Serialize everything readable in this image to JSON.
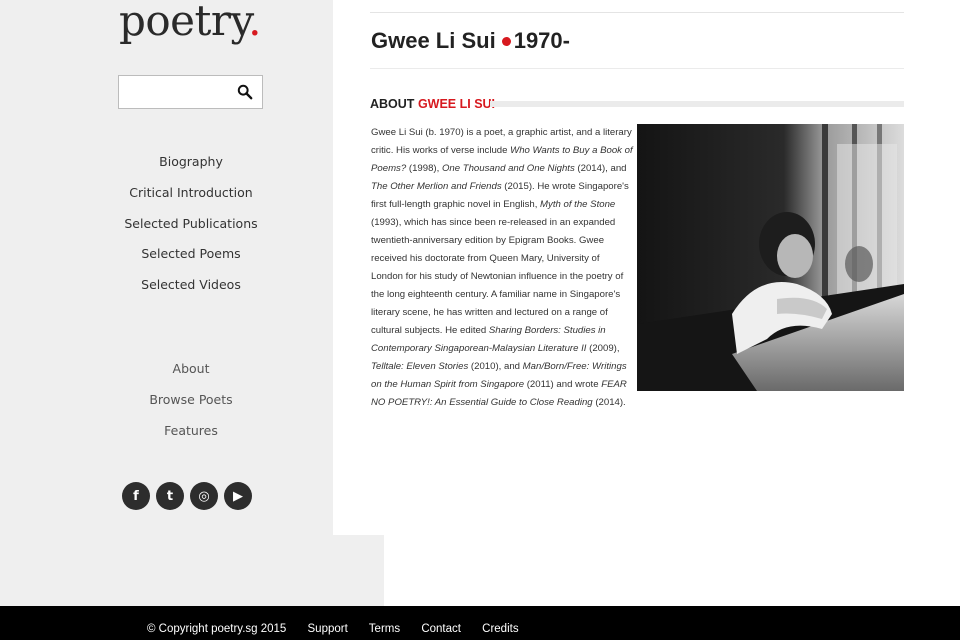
{
  "logo": {
    "text": "poetry",
    "dot": "."
  },
  "search": {
    "placeholder": "",
    "value": ""
  },
  "nav_primary": [
    "Biography",
    "Critical Introduction",
    "Selected Publications",
    "Selected Poems",
    "Selected Videos"
  ],
  "nav_secondary": [
    "About",
    "Browse Poets",
    "Features"
  ],
  "social": [
    {
      "icon": "facebook-icon",
      "glyph": "f"
    },
    {
      "icon": "twitter-icon",
      "glyph": "t"
    },
    {
      "icon": "instagram-icon",
      "glyph": "◎"
    },
    {
      "icon": "youtube-icon",
      "glyph": "▶"
    }
  ],
  "poet": {
    "name": "Gwee Li Sui",
    "years": "1970-"
  },
  "about": {
    "prefix": "ABOUT",
    "name": "GWEE LI SUI"
  },
  "bio": [
    {
      "t": "Gwee Li Sui (b. 1970) is a poet, a graphic artist, and a literary critic. His works of verse include "
    },
    {
      "t": "Who Wants to Buy a Book of Poems?",
      "i": true
    },
    {
      "t": " (1998), "
    },
    {
      "t": "One Thousand and One Nights",
      "i": true
    },
    {
      "t": " (2014), and "
    },
    {
      "t": "The Other Merlion and Friends",
      "i": true
    },
    {
      "t": " (2015). He wrote Singapore's first full-length graphic novel in English, "
    },
    {
      "t": "Myth of the Stone",
      "i": true
    },
    {
      "t": " (1993), which has since been re-released in an expanded twentieth-anniversary edition by Epigram Books. Gwee received his doctorate from Queen Mary, University of London for his study of Newtonian influence in the poetry of the long eighteenth century. A familiar name in Singapore's literary scene, he has written and lectured on a range of cultural subjects. He edited "
    },
    {
      "t": "Sharing Borders: Studies in Contemporary Singaporean-Malaysian Literature II",
      "i": true
    },
    {
      "t": " (2009), "
    },
    {
      "t": "Telltale: Eleven Stories",
      "i": true
    },
    {
      "t": " (2010), and "
    },
    {
      "t": "Man/Born/Free: Writings on the Human Spirit from Singapore",
      "i": true
    },
    {
      "t": " (2011) and wrote "
    },
    {
      "t": "FEAR NO POETRY!: An Essential Guide to Close Reading",
      "i": true
    },
    {
      "t": " (2014)."
    }
  ],
  "footer": {
    "copyright": "© Copyright poetry.sg 2015",
    "links": [
      "Support",
      "Terms",
      "Contact",
      "Credits"
    ]
  },
  "colors": {
    "accent": "#d7191f",
    "sidebar": "#efefef",
    "footer": "#000000"
  }
}
